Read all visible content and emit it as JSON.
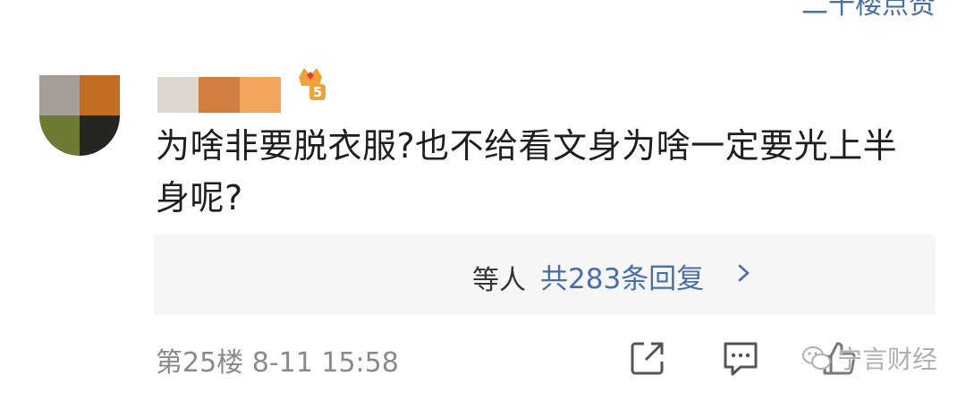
{
  "header": {
    "top_link_fragment": "二十楼点赞"
  },
  "comment": {
    "username_colors": [
      "#ded7d0",
      "#cf7e40",
      "#f2a55c"
    ],
    "avatar_colors": [
      "#a59d97",
      "#c26d24",
      "#6c7a34",
      "#252522"
    ],
    "vip_level": "5",
    "text": "为啥非要脱衣服?也不给看文身为啥一定要光上半身呢?",
    "reply_box": {
      "who": "等人",
      "count": "共283条回复"
    },
    "floor": "第25楼",
    "timestamp": "8-11 15:58"
  },
  "actions": {
    "share_icon": "share-icon",
    "comment_icon": "comment-icon",
    "like_icon": "like-icon"
  },
  "watermark": {
    "brand": "宁言财经",
    "icon": "wechat-icon"
  },
  "colors": {
    "link": "#4a6fa5",
    "meta": "#8a8a8a",
    "reply_bg": "#f6f6f6",
    "vip_badge": "#f0a23a"
  }
}
